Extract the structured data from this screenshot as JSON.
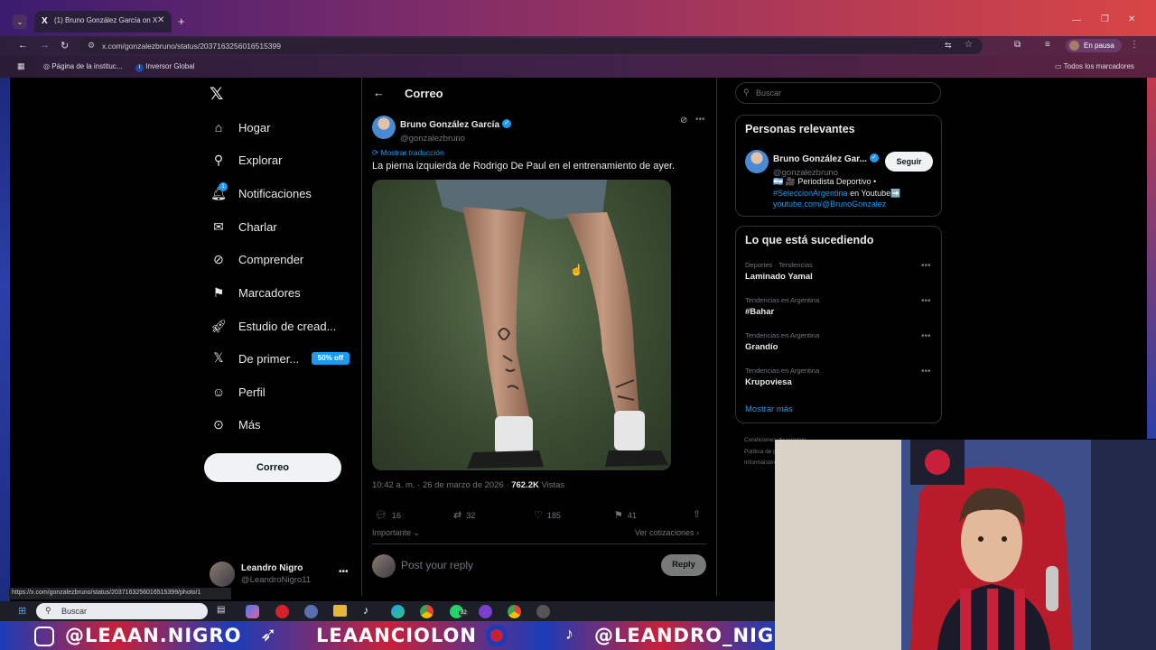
{
  "browser": {
    "tab_title": "(1) Bruno González García on X",
    "url": "x.com/gonzalezbruno/status/2037163256016515399",
    "bookmarks": [
      "Página de la instituc...",
      "Inversor Global"
    ],
    "all_bookmarks": "Todos los marcadores",
    "profile_status": "En pausa",
    "status_url": "https://x.com/gonzalezbruno/status/2037163256016515399/photo/1"
  },
  "sidebar": {
    "items": [
      {
        "label": "Hogar",
        "icon": "home-icon"
      },
      {
        "label": "Explorar",
        "icon": "search-icon"
      },
      {
        "label": "Notificaciones",
        "icon": "bell-icon"
      },
      {
        "label": "Charlar",
        "icon": "mail-icon"
      },
      {
        "label": "Comprender",
        "icon": "grok-icon"
      },
      {
        "label": "Marcadores",
        "icon": "bookmark-icon"
      },
      {
        "label": "Estudio de cread...",
        "icon": "rocket-icon"
      },
      {
        "label": "De primer...",
        "icon": "x-logo-icon"
      },
      {
        "label": "Perfil",
        "icon": "user-icon"
      },
      {
        "label": "Más",
        "icon": "more-icon"
      }
    ],
    "premium_badge": "50% off",
    "post_button": "Correo",
    "notif_count": "1",
    "account_name": "Leandro Nigro",
    "account_handle": "@LeandroNigro11"
  },
  "post": {
    "header_title": "Correo",
    "author_name": "Bruno González García",
    "author_handle": "@gonzalezbruno",
    "translate": "Mostrar traducción",
    "text": "La pierna izquierda de Rodrigo De Paul en el entrenamiento de ayer.",
    "time": "10:42 a. m. · 26 de marzo de 2026 ·",
    "views_count": "762.2K",
    "views_label": "Vistas",
    "replies": "16",
    "reposts": "32",
    "likes": "185",
    "bookmarks": "41",
    "relevance": "Importante",
    "quotes": "Ver cotizaciones",
    "reply_placeholder": "Post your reply",
    "reply_button": "Reply"
  },
  "right": {
    "search_placeholder": "Buscar",
    "relevant_title": "Personas relevantes",
    "person_name": "Bruno González Gar...",
    "person_handle": "@gonzalezbruno",
    "follow": "Seguir",
    "bio_1": "🇦🇷 🎥 Periodista Deportivo •",
    "bio_tag": "#SeleccionArgentina",
    "bio_mid": " en Youtube➡️",
    "bio_link": "youtube.com/@BrunoGonzalez",
    "trending_title": "Lo que está sucediendo",
    "trends": [
      {
        "cat": "Deportes · Tendencias",
        "name": "Laminado Yamal"
      },
      {
        "cat": "Tendencias en Argentina",
        "name": "#Bahar"
      },
      {
        "cat": "Tendencias en Argentina",
        "name": "Grandío"
      },
      {
        "cat": "Tendencias en Argentina",
        "name": "Krupoviesa"
      }
    ],
    "show_more": "Mostrar más",
    "footer_1": "Condiciones de servicio",
    "footer_2": "Política de privacidad",
    "footer_3": "Información"
  },
  "taskbar": {
    "search": "Buscar",
    "whatsapp_badge": "82"
  },
  "banner": {
    "left": "@LEAAN.NIGRO",
    "mid": "LEAANCIOLON",
    "right": "@LEANDRO_NIGRO"
  }
}
